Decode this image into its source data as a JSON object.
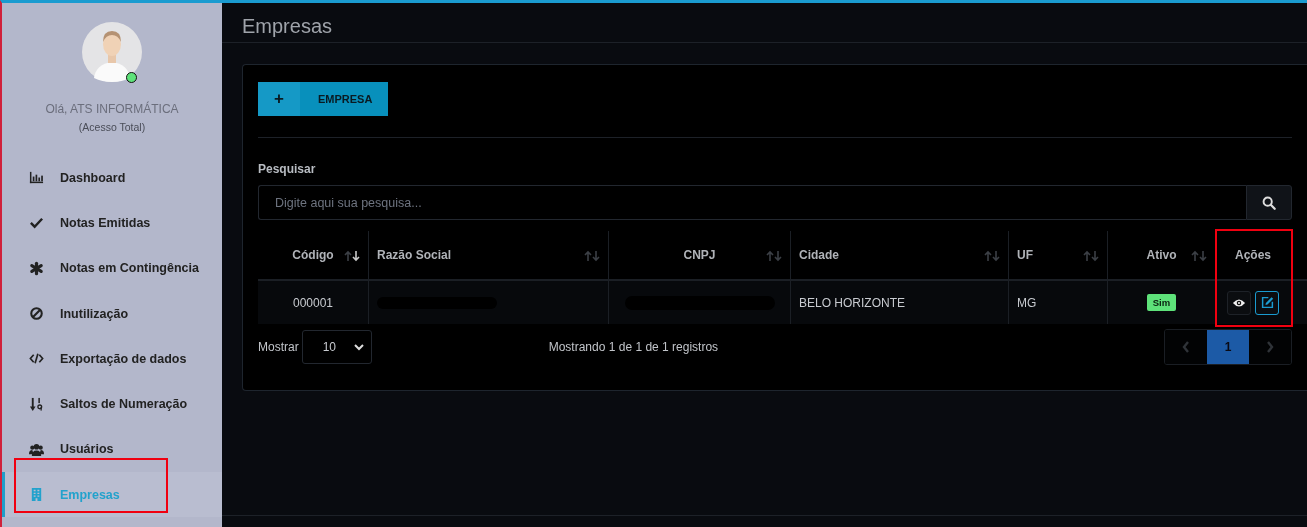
{
  "sidebar": {
    "greeting": "Olá, ATS INFORMÁTICA",
    "access": "(Acesso Total)",
    "online": true,
    "items": [
      {
        "label": "Dashboard",
        "selected": false,
        "highlighted": false
      },
      {
        "label": "Notas Emitidas",
        "selected": false,
        "highlighted": false
      },
      {
        "label": "Notas em Contingência",
        "selected": false,
        "highlighted": false
      },
      {
        "label": "Inutilização",
        "selected": false,
        "highlighted": false
      },
      {
        "label": "Exportação de dados",
        "selected": false,
        "highlighted": false
      },
      {
        "label": "Saltos de Numeração",
        "selected": false,
        "highlighted": false
      },
      {
        "label": "Usuários",
        "selected": false,
        "highlighted": false
      },
      {
        "label": "Empresas",
        "selected": true,
        "highlighted": true
      }
    ]
  },
  "page": {
    "title": "Empresas"
  },
  "add_button": {
    "icon": "+",
    "label": "EMPRESA"
  },
  "search": {
    "label": "Pesquisar",
    "placeholder": "Digite aqui sua pesquisa..."
  },
  "table": {
    "columns": [
      {
        "label": "Código",
        "sorted": true
      },
      {
        "label": "Razão Social",
        "sorted": false
      },
      {
        "label": "CNPJ",
        "sorted": false
      },
      {
        "label": "Cidade",
        "sorted": false
      },
      {
        "label": "UF",
        "sorted": false
      },
      {
        "label": "Ativo",
        "sorted": false
      },
      {
        "label": "Ações"
      }
    ],
    "rows": [
      {
        "codigo": "000001",
        "razao_redacted": true,
        "cnpj_redacted": true,
        "cidade": "BELO HORIZONTE",
        "uf": "MG",
        "ativo": "Sim",
        "actions_highlighted": true
      }
    ]
  },
  "footer": {
    "show_label": "Mostrar",
    "page_size": "10",
    "info": "Mostrando 1 de 1 de 1 registros",
    "pages": [
      {
        "label": "1",
        "selected": true
      }
    ]
  }
}
